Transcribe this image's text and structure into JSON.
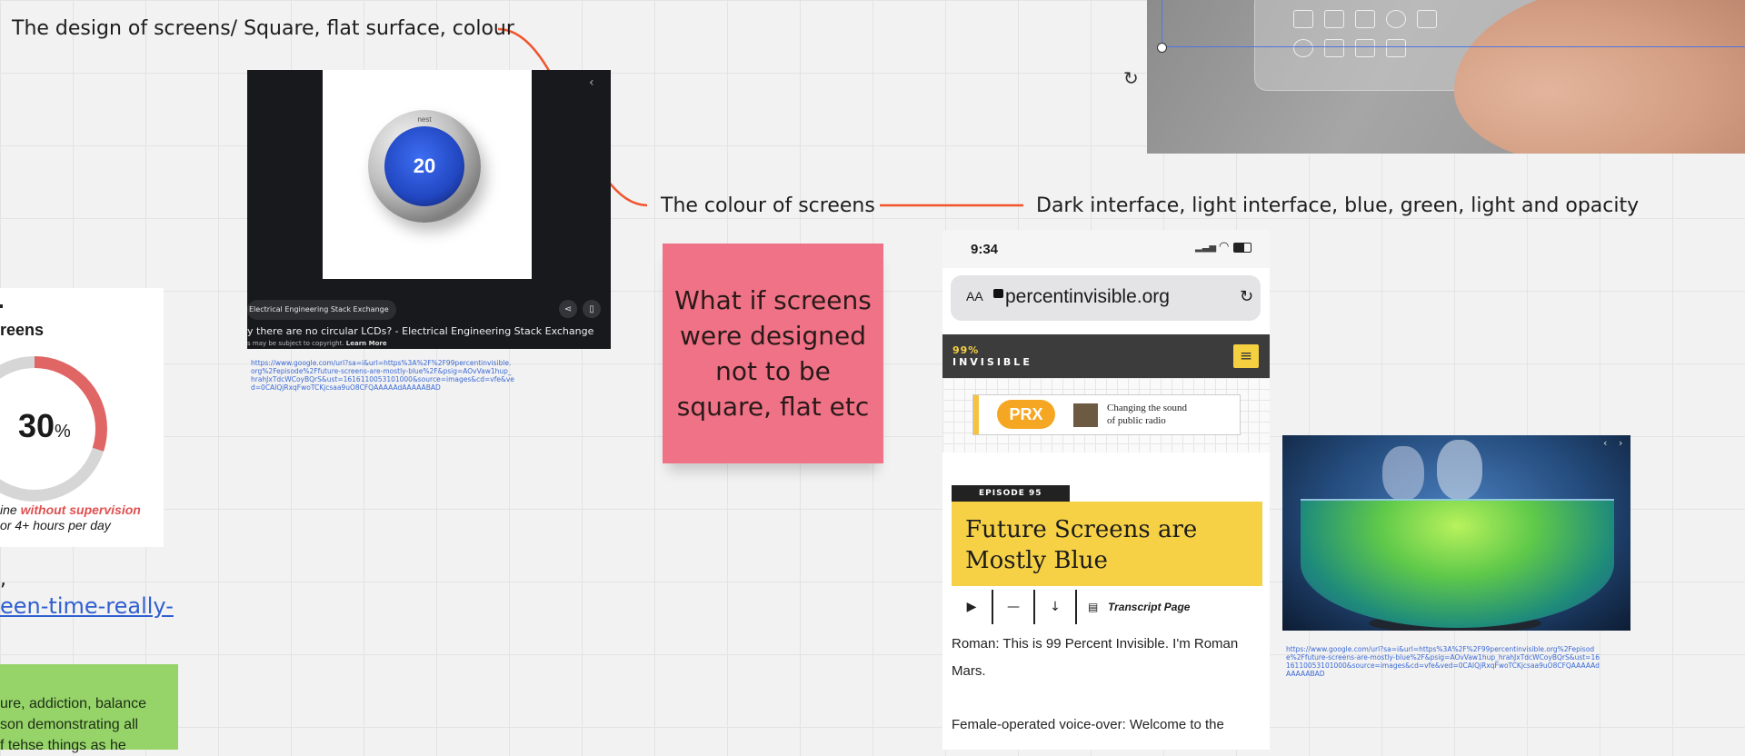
{
  "labels": {
    "design_of_screens": "The design of screens/ Square, flat surface, colour",
    "colour_of_screens": "The colour of screens",
    "interfaces": "Dark interface, light interface, blue, green, light and opacity"
  },
  "sticky_note": {
    "text": "What if screens were designed not to be square, flat etc"
  },
  "nest_card": {
    "brand": "nest",
    "temperature": "20",
    "source_chip": "Electrical Engineering Stack Exchange",
    "title": "y there are no circular LCDs? - Electrical Engineering Stack Exchange",
    "copyright_note": "s may be subject to copyright.",
    "learn_more": "Learn More",
    "link": "https://www.google.com/url?sa=i&url=https%3A%2F%2F99percentinvisible.org%2Fepisode%2Ffuture-screens-are-mostly-blue%2F&psig=AOvVaw1hup_hrahJxTdcWCoyBQrS&ust=1616110053101000&source=images&cd=vfe&ved=0CAIQjRxqFwoTCKjcsaa9uO8CFQAAAAAdAAAAABAD"
  },
  "phone": {
    "time": "9:34",
    "aa": "AA",
    "domain": "percentinvisible.org",
    "logo_top": "99%",
    "logo_bottom": "INVISIBLE",
    "banner_logo": "PRX",
    "banner_tagline_1": "Changing the sound",
    "banner_tagline_2": "of public radio",
    "episode": "EPISODE 95",
    "title": "Future Screens are Mostly Blue",
    "transcript": "Transcript Page",
    "body_1": "Roman: This is 99 Percent Invisible. I'm Roman Mars.",
    "body_2": "Female-operated voice-over: Welcome to the"
  },
  "infographic": {
    "heading": "reens",
    "percent": "30",
    "percent_sign": "%",
    "ring_fraction": 0.3,
    "line1_a": "ine ",
    "line1_b": "without supervision",
    "line2": "or 4+ hours per day"
  },
  "left_link": {
    "comma": ",",
    "text": "een-time-really-"
  },
  "green_note": {
    "line1": "ure, addiction, balance",
    "line2": " son demonstrating all",
    "line3": "f tehse things as he"
  },
  "holo_card": {
    "link": "https://www.google.com/url?sa=i&url=https%3A%2F%2F99percentinvisible.org%2Fepisode%2Ffuture-screens-are-mostly-blue%2F&psig=AOvVaw1hup_hrahJxTdcWCoyBQrS&ust=1616110053101000&source=images&cd=vfe&ved=0CAIQjRxqFwoTCKjcsaa9uO8CFQAAAAAdAAAAABAD"
  },
  "colors": {
    "connector": "#f0542d",
    "sticky": "#f07286",
    "green_note": "#96d46a",
    "selection": "#4f76e0",
    "episode_yellow": "#f6d145"
  }
}
